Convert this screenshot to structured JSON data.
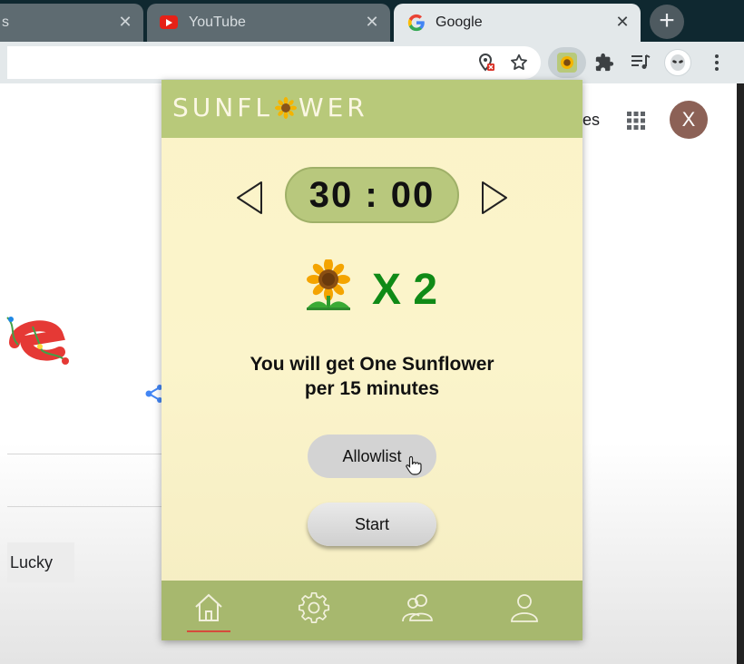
{
  "browser": {
    "tabs": [
      {
        "label": "s",
        "close": "✕"
      },
      {
        "label": "YouTube",
        "close": "✕"
      },
      {
        "label": "Google",
        "close": "✕",
        "active": true
      }
    ],
    "new_tab_label": "+"
  },
  "page": {
    "header_partial_text": "es",
    "account_initial": "X",
    "lucky_button": "Lucky"
  },
  "popup": {
    "brand_left": "SUNFL",
    "brand_right": "WER",
    "timer": "30 : 00",
    "reward": "X 2",
    "info_line1": "You will get One Sunflower",
    "info_line2": "per 15 minutes",
    "allowlist_button": "Allowlist",
    "start_button": "Start",
    "nav": [
      "home-icon",
      "settings-icon",
      "friends-icon",
      "profile-icon"
    ],
    "colors": {
      "header": "#b8c97a",
      "background": "#fbf3c8",
      "nav": "#a7b86e",
      "reward_text": "#0f8a16",
      "timer_pill": "#b8c87d"
    }
  }
}
